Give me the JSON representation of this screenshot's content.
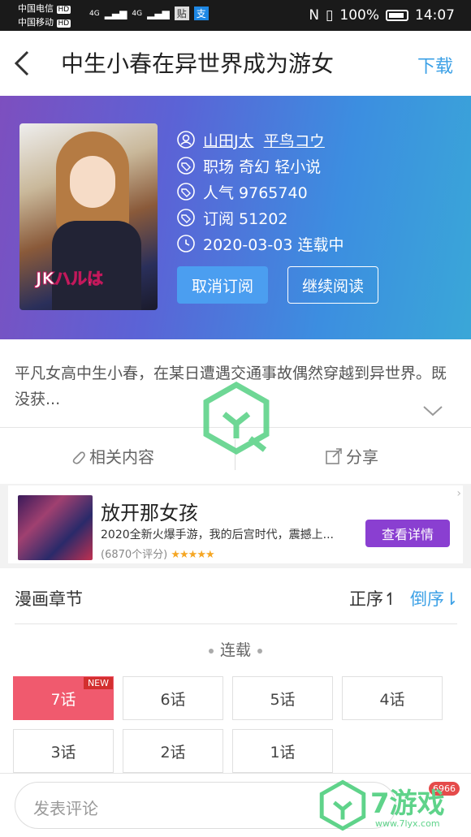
{
  "status_bar": {
    "carrier1": "中国电信",
    "carrier2": "中国移动",
    "hd1": "HD",
    "hd2": "HD",
    "net": "4G",
    "battery": "100%",
    "time": "14:07"
  },
  "nav": {
    "title": "中生小春在异世界成为游女",
    "download_label": "下载"
  },
  "comic": {
    "authors": [
      "山田J太",
      "平鸟コウ"
    ],
    "tags": "职场 奇幻 轻小说",
    "popularity": "人气 9765740",
    "subscriptions": "订阅 51202",
    "status": "2020-03-03 连载中",
    "unsubscribe_label": "取消订阅",
    "continue_label": "继续阅读",
    "cover_text": "JKハルは"
  },
  "description": {
    "text": "平凡女高中生小春，在某日遭遇交通事故偶然穿越到异世界。既没获..."
  },
  "actions": {
    "related": "相关内容",
    "share": "分享"
  },
  "ad": {
    "title": "放开那女孩",
    "desc": "2020全新火爆手游，我的后宫时代，震撼上...",
    "rating": "(6870个评分)",
    "stars": "★★★★★",
    "button": "查看详情"
  },
  "chapters": {
    "title": "漫画章节",
    "asc": "正序↿",
    "desc": "倒序⇂",
    "serial": "连载",
    "new_tag": "NEW",
    "items": [
      "7话",
      "6话",
      "5话",
      "4话",
      "3话",
      "2话",
      "1话"
    ]
  },
  "comment": {
    "placeholder": "发表评论",
    "badge": "6966"
  },
  "watermark": {
    "site": "7游戏",
    "url": "www.7lyx.com"
  },
  "colors": {
    "accent": "#3ba0e6",
    "active_chapter": "#f05a6e",
    "ad_button": "#8a3fd1",
    "watermark_green": "#5fd38a"
  }
}
